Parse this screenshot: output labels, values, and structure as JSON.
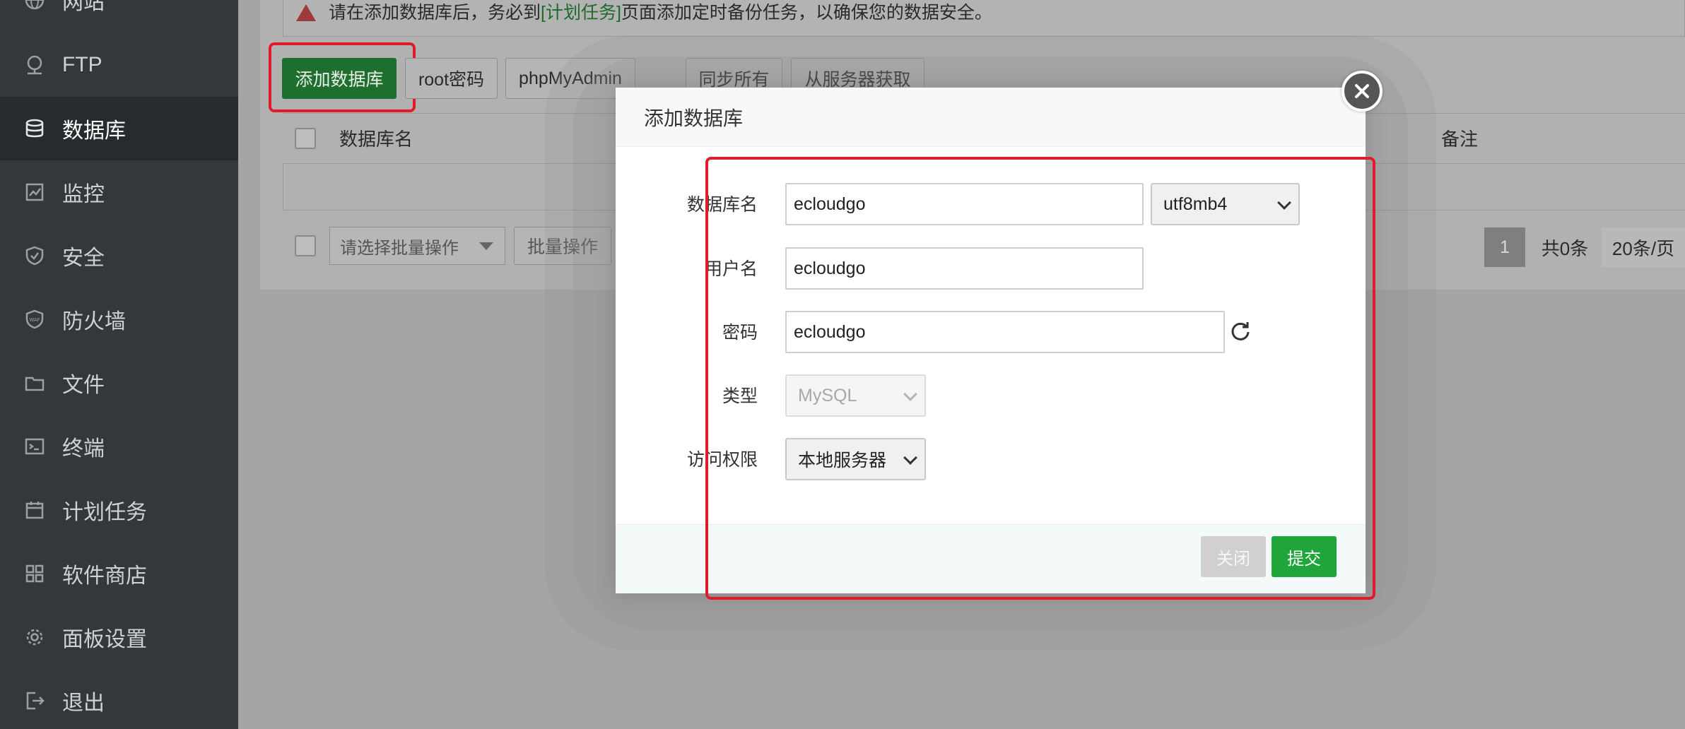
{
  "sidebar": {
    "items": [
      {
        "label": "网站",
        "icon": "globe-icon"
      },
      {
        "label": "FTP",
        "icon": "ftp-icon"
      },
      {
        "label": "数据库",
        "icon": "database-icon",
        "active": true
      },
      {
        "label": "监控",
        "icon": "monitor-icon"
      },
      {
        "label": "安全",
        "icon": "shield-icon"
      },
      {
        "label": "防火墙",
        "icon": "waf-icon"
      },
      {
        "label": "文件",
        "icon": "folder-icon"
      },
      {
        "label": "终端",
        "icon": "terminal-icon"
      },
      {
        "label": "计划任务",
        "icon": "calendar-icon"
      },
      {
        "label": "软件商店",
        "icon": "apps-icon"
      },
      {
        "label": "面板设置",
        "icon": "gear-icon"
      },
      {
        "label": "退出",
        "icon": "logout-icon"
      }
    ]
  },
  "alert": {
    "prefix": "请在添加数据库后，务必到",
    "link": "[计划任务]",
    "suffix": "页面添加定时备份任务，以确保您的数据安全。"
  },
  "toolbar": {
    "add_db": "添加数据库",
    "root_pwd": "root密码",
    "phpmyadmin": "phpMyAdmin",
    "sync_all": "同步所有",
    "fetch_server": "从服务器获取"
  },
  "table": {
    "col_name": "数据库名",
    "col_remark": "备注"
  },
  "batch": {
    "placeholder": "请选择批量操作",
    "button": "批量操作"
  },
  "pager": {
    "current": "1",
    "total": "共0条",
    "per_page": "20条/页"
  },
  "modal": {
    "title": "添加数据库",
    "fields": {
      "db_name_label": "数据库名",
      "db_name_value": "ecloudgo",
      "charset": "utf8mb4",
      "user_label": "用户名",
      "user_value": "ecloudgo",
      "password_label": "密码",
      "password_value": "ecloudgo",
      "type_label": "类型",
      "type_value": "MySQL",
      "access_label": "访问权限",
      "access_value": "本地服务器"
    },
    "close_label": "关闭",
    "submit_label": "提交"
  },
  "colors": {
    "accent_green": "#20a53a",
    "highlight_red": "#e01b2a",
    "sidebar_bg": "#32383c"
  }
}
